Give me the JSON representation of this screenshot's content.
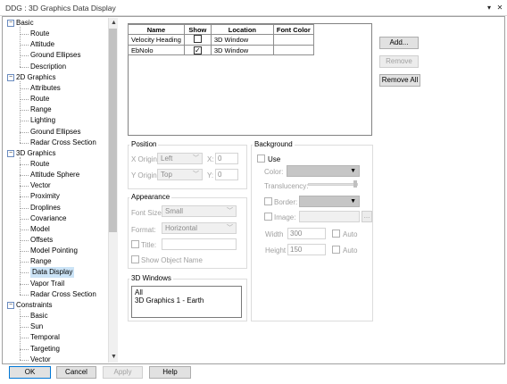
{
  "window": {
    "title": "DDG : 3D Graphics Data Display",
    "menu_glyph": "▾",
    "close_glyph": "✕"
  },
  "tree": {
    "groups": [
      {
        "label": "Basic",
        "expander": "−",
        "children": [
          "Route",
          "Attitude",
          "Ground Ellipses",
          "Description"
        ]
      },
      {
        "label": "2D Graphics",
        "expander": "−",
        "children": [
          "Attributes",
          "Route",
          "Range",
          "Lighting",
          "Ground Ellipses",
          "Radar Cross Section"
        ]
      },
      {
        "label": "3D Graphics",
        "expander": "−",
        "children": [
          "Route",
          "Attitude Sphere",
          "Vector",
          "Proximity",
          "Droplines",
          "Covariance",
          "Model",
          "Offsets",
          "Model Pointing",
          "Range",
          "Data Display",
          "Vapor Trail",
          "Radar Cross Section"
        ]
      },
      {
        "label": "Constraints",
        "expander": "−",
        "children": [
          "Basic",
          "Sun",
          "Temporal",
          "Targeting",
          "Vector"
        ]
      }
    ],
    "selected": "Data Display",
    "scroll_up": "▲",
    "scroll_down": "▼"
  },
  "grid": {
    "headers": [
      "Name",
      "Show",
      "Location",
      "Font Color"
    ],
    "rows": [
      {
        "name": "Velocity Heading",
        "show": "",
        "location": "3D Window",
        "font_color": ""
      },
      {
        "name": "EbNolo",
        "show": "✓",
        "location": "3D Window",
        "font_color": ""
      }
    ]
  },
  "buttons": {
    "add": "Add...",
    "remove": "Remove",
    "remove_all": "Remove All"
  },
  "position": {
    "title": "Position",
    "x_origin_label": "X Origin:",
    "x_origin_value": "Left",
    "x_label": "X:",
    "x_value": "0",
    "y_origin_label": "Y Origin:",
    "y_origin_value": "Top",
    "y_label": "Y:",
    "y_value": "0"
  },
  "appearance": {
    "title": "Appearance",
    "font_size_label": "Font Size:",
    "font_size_value": "Small",
    "format_label": "Format:",
    "format_value": "Horizontal",
    "title_label": "Title:",
    "title_value": "",
    "show_object_name_label": "Show Object Name"
  },
  "windows_3d": {
    "title": "3D Windows",
    "items": [
      "All",
      "3D Graphics 1 - Earth"
    ]
  },
  "background": {
    "title": "Background",
    "use_label": "Use",
    "color_label": "Color:",
    "translucency_label": "Translucency:",
    "border_label": "Border:",
    "image_label": "Image:",
    "browse_label": "...",
    "width_label": "Width",
    "width_value": "300",
    "height_label": "Height",
    "height_value": "150",
    "auto_label": "Auto"
  },
  "footer": {
    "ok": "OK",
    "cancel": "Cancel",
    "apply": "Apply",
    "help": "Help"
  }
}
